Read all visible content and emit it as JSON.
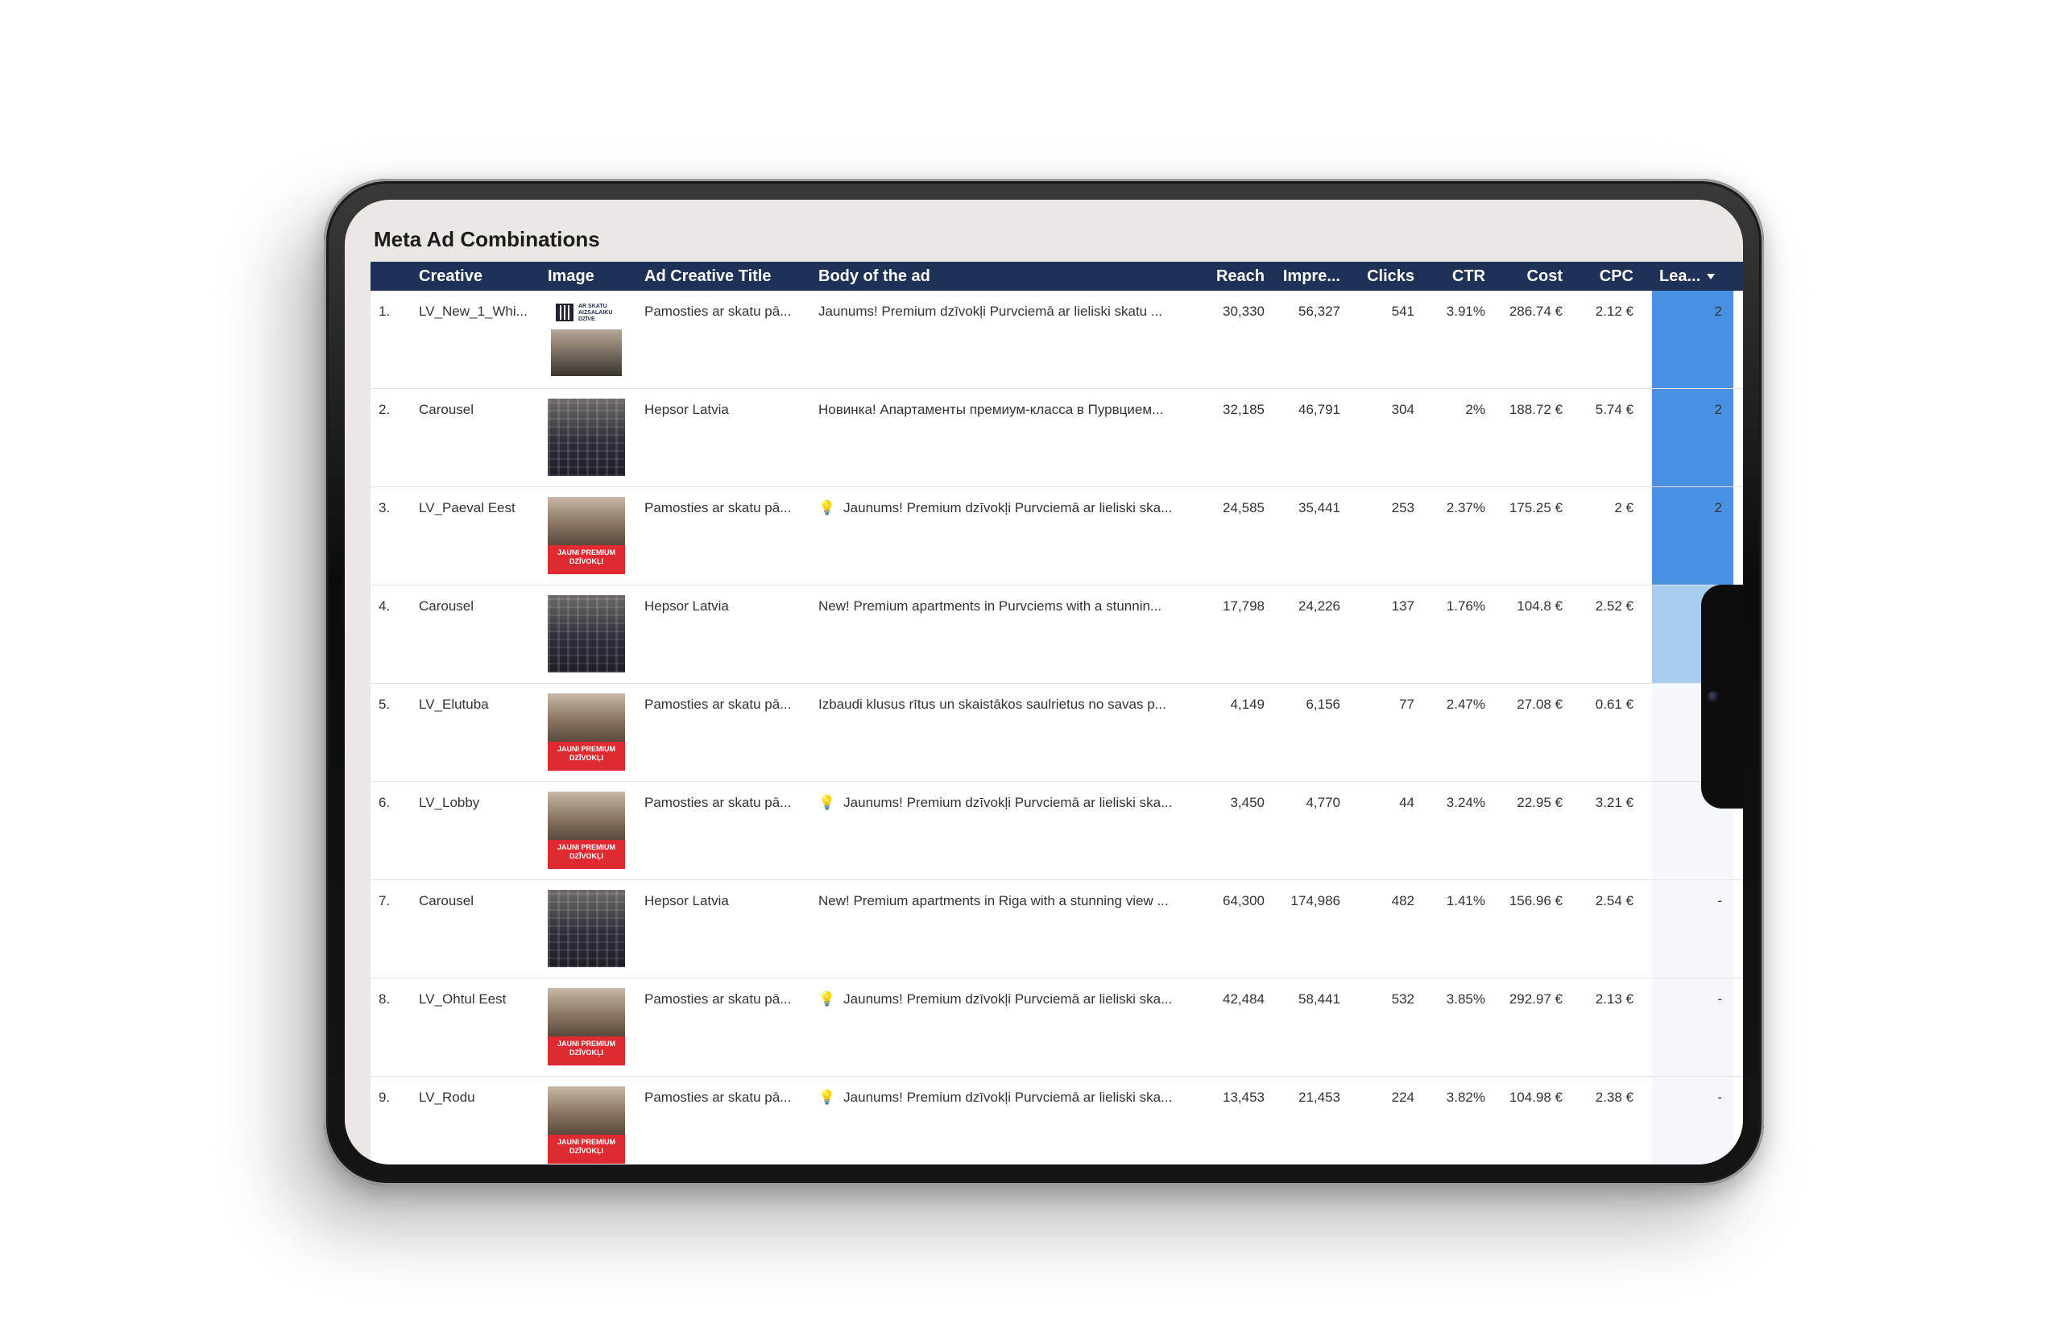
{
  "report": {
    "title": "Meta Ad Combinations"
  },
  "columns": {
    "creative": "Creative",
    "image": "Image",
    "title": "Ad Creative Title",
    "body": "Body of the ad",
    "reach": "Reach",
    "impressions": "Impre...",
    "clicks": "Clicks",
    "ctr": "CTR",
    "cost": "Cost",
    "cpc": "CPC",
    "leads": "Lea..."
  },
  "colors": {
    "header_bg": "#1e3156",
    "lead_high": "#4a90e2",
    "lead_mid": "#a9cdf0",
    "lead_empty": "#f4f8fd"
  },
  "rows": [
    {
      "index": "1.",
      "creative": "LV_New_1_Whi...",
      "image": "qr-interior",
      "title": "Pamosties ar skatu pā...",
      "bulb": false,
      "body": "Jaunums! Premium dzīvokļi Purvciemā ar lieliski skatu ...",
      "reach": "30,330",
      "impressions": "56,327",
      "clicks": "541",
      "ctr": "3.91%",
      "cost": "286.74 €",
      "cpc": "2.12 €",
      "leads": "2",
      "lead_level": "high"
    },
    {
      "index": "2.",
      "creative": "Carousel",
      "image": "building",
      "title": "Hepsor Latvia",
      "bulb": false,
      "body": "Новинка! Апартаменты премиум-класса в Пурвцием...",
      "reach": "32,185",
      "impressions": "46,791",
      "clicks": "304",
      "ctr": "2%",
      "cost": "188.72 €",
      "cpc": "5.74 €",
      "leads": "2",
      "lead_level": "high"
    },
    {
      "index": "3.",
      "creative": "LV_Paeval Eest",
      "image": "red-banner",
      "title": "Pamosties ar skatu pā...",
      "bulb": true,
      "body": "Jaunums! Premium dzīvokļi Purvciemā ar lieliski ska...",
      "reach": "24,585",
      "impressions": "35,441",
      "clicks": "253",
      "ctr": "2.37%",
      "cost": "175.25 €",
      "cpc": "2 €",
      "leads": "2",
      "lead_level": "high"
    },
    {
      "index": "4.",
      "creative": "Carousel",
      "image": "building",
      "title": "Hepsor Latvia",
      "bulb": false,
      "body": "New! Premium apartments in Purvciems with a stunnin...",
      "reach": "17,798",
      "impressions": "24,226",
      "clicks": "137",
      "ctr": "1.76%",
      "cost": "104.8 €",
      "cpc": "2.52 €",
      "leads": "",
      "lead_level": "mid"
    },
    {
      "index": "5.",
      "creative": "LV_Elutuba",
      "image": "red-banner",
      "title": "Pamosties ar skatu pā...",
      "bulb": false,
      "body": "Izbaudi klusus rītus un skaistākos saulrietus no savas p...",
      "reach": "4,149",
      "impressions": "6,156",
      "clicks": "77",
      "ctr": "2.47%",
      "cost": "27.08 €",
      "cpc": "0.61 €",
      "leads": "",
      "lead_level": "empty"
    },
    {
      "index": "6.",
      "creative": "LV_Lobby",
      "image": "red-banner",
      "title": "Pamosties ar skatu pā...",
      "bulb": true,
      "body": "Jaunums! Premium dzīvokļi Purvciemā ar lieliski ska...",
      "reach": "3,450",
      "impressions": "4,770",
      "clicks": "44",
      "ctr": "3.24%",
      "cost": "22.95 €",
      "cpc": "3.21 €",
      "leads": "",
      "lead_level": "empty"
    },
    {
      "index": "7.",
      "creative": "Carousel",
      "image": "building",
      "title": "Hepsor Latvia",
      "bulb": false,
      "body": "New! Premium apartments in Riga with a stunning view ...",
      "reach": "64,300",
      "impressions": "174,986",
      "clicks": "482",
      "ctr": "1.41%",
      "cost": "156.96 €",
      "cpc": "2.54 €",
      "leads": "-",
      "lead_level": "empty"
    },
    {
      "index": "8.",
      "creative": "LV_Ohtul Eest",
      "image": "red-banner",
      "title": "Pamosties ar skatu pā...",
      "bulb": true,
      "body": "Jaunums! Premium dzīvokļi Purvciemā ar lieliski ska...",
      "reach": "42,484",
      "impressions": "58,441",
      "clicks": "532",
      "ctr": "3.85%",
      "cost": "292.97 €",
      "cpc": "2.13 €",
      "leads": "-",
      "lead_level": "empty"
    },
    {
      "index": "9.",
      "creative": "LV_Rodu",
      "image": "red-banner",
      "title": "Pamosties ar skatu pā...",
      "bulb": true,
      "body": "Jaunums! Premium dzīvokļi Purvciemā ar lieliski ska...",
      "reach": "13,453",
      "impressions": "21,453",
      "clicks": "224",
      "ctr": "3.82%",
      "cost": "104.98 €",
      "cpc": "2.38 €",
      "leads": "-",
      "lead_level": "empty"
    }
  ],
  "thumb_banner_text": "JAUNI PREMIUM DZĪVOKĻI",
  "thumb_qr_text": "AR SKATU AIZSALAIKU DZĪVE"
}
